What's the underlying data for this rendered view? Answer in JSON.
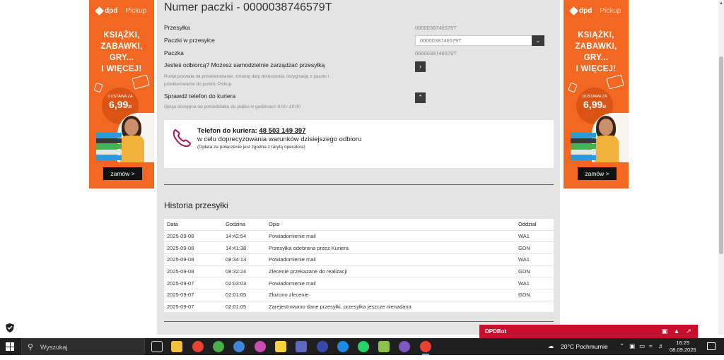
{
  "ad": {
    "brand": "dpd",
    "brand_sub": "Pickup",
    "headline_lines": [
      "KSIĄŻKI,",
      "ZABAWKI,",
      "GRY...",
      "I WIĘCEJ!"
    ],
    "price_label": "DOSTAWA ZA",
    "price": "6,99",
    "price_unit": "zł",
    "order_label": "zamów >"
  },
  "parcel": {
    "title": "Numer paczki - 0000038746579T",
    "rows": {
      "shipment_label": "Przesyłka",
      "shipment_value": "0000038746579T",
      "parcels_label": "Paczki w przesyłce",
      "parcels_select_value": "0000038746579T",
      "parcel_label": "Paczka",
      "parcel_value": "0000038746579T",
      "recipient_label": "Jesteś odbiorcą? Możesz samodzielnie zarządzać przesyłką",
      "recipient_desc_1": "Portal pozwala na przekierowanie, zmianę daty doręczenia, rezygnację z paczki i",
      "recipient_desc_2": "przekierowanie do punktu Pickup",
      "phone_label": "Sprawdź telefon do kuriera",
      "phone_desc": "Opcja dostępna od poniedziałku do piątku w godzinach 8:00–19:00"
    }
  },
  "courier": {
    "label": "Telefon do kuriera:",
    "number": "48 503 149 397",
    "subtitle": "w celu doprecyzowania warunków dzisiejszego odbioru",
    "note": "(Opłata za połączenie jest zgodna z taryfą operatora)"
  },
  "history": {
    "title": "Historia przesyłki",
    "columns": [
      "Data",
      "Godzina",
      "Opis",
      "Oddział"
    ],
    "rows": [
      [
        "2025-09-08",
        "14:42:54",
        "Powiadomienie mail",
        "WA1"
      ],
      [
        "2025-09-08",
        "14:41:38",
        "Przesyłka odebrana przez Kuriera",
        "GDN"
      ],
      [
        "2025-09-08",
        "08:34:13",
        "Powiadomienie mail",
        "WA1"
      ],
      [
        "2025-09-08",
        "08:32:24",
        "Zlecenie przekazane do realizacji",
        "GDN"
      ],
      [
        "2025-09-07",
        "02:03:03",
        "Powiadomienie mail",
        "WA1"
      ],
      [
        "2025-09-07",
        "02:01:05",
        "Złożono zlecenie",
        "GDN"
      ],
      [
        "2025-09-07",
        "02:01:05",
        "Zarejestrowano dane przesyłki, przesyłka jeszcze nienadana",
        ""
      ]
    ]
  },
  "bot": {
    "name": "DPDBot"
  },
  "taskbar": {
    "search_placeholder": "Wyszukaj",
    "weather": "20°C  Pochmurnie",
    "time": "16:25",
    "date": "08.09.2025"
  },
  "colors": {
    "dpd_orange": "#f26722",
    "dpd_red": "#c8102e",
    "panel_gray": "#e4e4e4"
  }
}
